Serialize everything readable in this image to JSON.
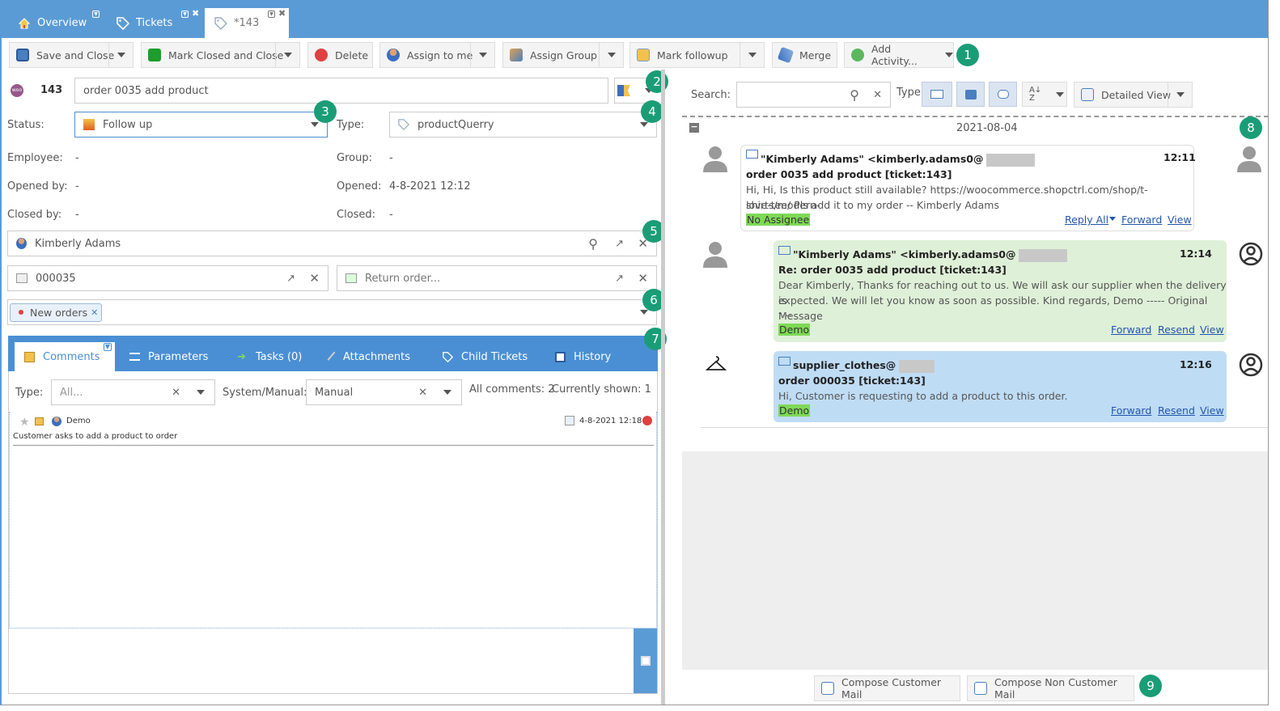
{
  "tabs": [
    {
      "label": "Overview",
      "icon": "home-icon"
    },
    {
      "label": "Tickets",
      "icon": "tag-icon"
    },
    {
      "label": "*143",
      "icon": "tag-icon"
    }
  ],
  "toolbar": {
    "save_close": "Save and Close",
    "mark_closed": "Mark Closed and Close",
    "delete": "Delete",
    "assign_me": "Assign to me",
    "assign_group": "Assign Group",
    "mark_followup": "Mark followup",
    "merge": "Merge",
    "add_activity": "Add Activity..."
  },
  "badges": [
    "1",
    "2",
    "3",
    "4",
    "5",
    "6",
    "7",
    "8",
    "9"
  ],
  "ticket": {
    "id": "143",
    "subject": "order 0035 add product",
    "status_label": "Status:",
    "status_value": "Follow up",
    "type_label": "Type:",
    "type_value": "productQuerry",
    "employee_label": "Employee:",
    "employee_value": "-",
    "group_label": "Group:",
    "group_value": "-",
    "opened_by_label": "Opened by:",
    "opened_by_value": "-",
    "opened_label": "Opened:",
    "opened_value": "4-8-2021 12:12",
    "closed_by_label": "Closed by:",
    "closed_by_value": "-",
    "closed_label": "Closed:",
    "closed_value": "-",
    "customer": "Kimberly Adams",
    "order": "000035",
    "return_placeholder": "Return order...",
    "tag": "New orders"
  },
  "comment_tabs": [
    "Comments",
    "Parameters",
    "Tasks (0)",
    "Attachments",
    "Child Tickets",
    "History"
  ],
  "comment_filters": {
    "type_label": "Type:",
    "type_placeholder": "All...",
    "sysman_label": "System/Manual:",
    "sysman_value": "Manual",
    "all_comments": "All comments: 2",
    "currently_shown": "Currently shown: 1"
  },
  "comment": {
    "author": "Demo",
    "date": "4-8-2021 12:18",
    "text": "Customer asks to add a product to order"
  },
  "right": {
    "search_label": "Search:",
    "type_label": "Type:",
    "view": "Detailed View",
    "date_header": "2021-08-04"
  },
  "messages": [
    {
      "from": "\"Kimberly Adams\" <kimberly.adams0@",
      "time": "12:11",
      "subject": "order 0035 add product [ticket:143]",
      "body1": "Hi, Hi, Is this product still available? https://woocommerce.shopctrl.com/shop/t-shirts/modern-",
      "body2": "love-tee/ Pls add it to my order -- Kimberly Adams",
      "who": "No Assignee",
      "links": [
        "Reply All",
        "Forward",
        "View"
      ]
    },
    {
      "from": "\"Kimberly Adams\" <kimberly.adams0@",
      "time": "12:14",
      "subject": "Re: order 0035 add product [ticket:143]",
      "body1": "Dear Kimberly, Thanks for reaching out to us. We will ask our supplier when the delivery is",
      "body2": "expected. We will let you know as soon as possible. Kind regards, Demo ----- Original Message",
      "body3": "-...",
      "who": "Demo",
      "links": [
        "Forward",
        "Resend",
        "View"
      ]
    },
    {
      "from": "supplier_clothes@",
      "time": "12:16",
      "subject": "order 000035 [ticket:143]",
      "body1": "Hi, Customer is requesting to add a product to this order.",
      "who": "Demo",
      "links": [
        "Forward",
        "Resend",
        "View"
      ]
    }
  ],
  "compose": {
    "customer": "Compose Customer Mail",
    "non_customer": "Compose Non Customer Mail"
  },
  "colors": {
    "accent": "#5b9bd5",
    "badge": "#1a9d77",
    "green_msg": "#dff0d8",
    "blue_msg": "#bfdcf5"
  }
}
